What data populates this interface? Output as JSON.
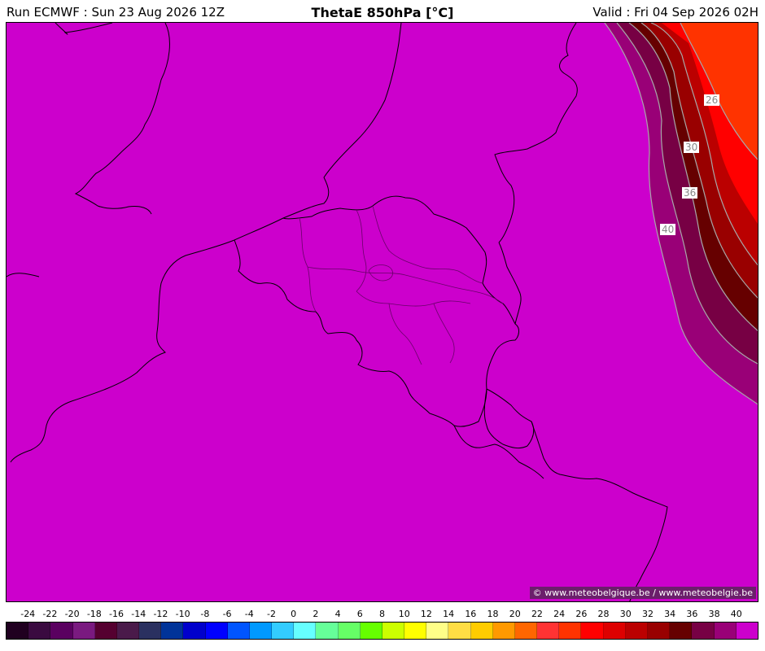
{
  "header": {
    "run": "Run ECMWF : Sun 23 Aug 2026 12Z",
    "title": "ThetaE 850hPa [°C]",
    "valid": "Valid : Fri 04 Sep 2026 02H"
  },
  "map": {
    "credit": "© www.meteobelgique.be / www.meteobelgie.be",
    "contour_labels": [
      "26",
      "30",
      "36",
      "40"
    ],
    "background_color": "#cc00cc"
  },
  "legend": {
    "labels": [
      "-24",
      "-22",
      "-20",
      "-18",
      "-16",
      "-14",
      "-12",
      "-10",
      "-8",
      "-6",
      "-4",
      "-2",
      "0",
      "2",
      "4",
      "6",
      "8",
      "10",
      "12",
      "14",
      "16",
      "18",
      "20",
      "22",
      "24",
      "26",
      "28",
      "30",
      "32",
      "34",
      "36",
      "38",
      "40"
    ],
    "colors": [
      "#200020",
      "#3a0a40",
      "#5a0060",
      "#7a1a80",
      "#550030",
      "#4a1a4a",
      "#2a3060",
      "#003399",
      "#0000cc",
      "#0000ff",
      "#0055ff",
      "#0099ff",
      "#33ccff",
      "#66ffff",
      "#66ff99",
      "#66ff66",
      "#66ff00",
      "#ccff00",
      "#ffff00",
      "#ffff88",
      "#ffdd44",
      "#ffcc00",
      "#ff9900",
      "#ff6600",
      "#ff3333",
      "#ff3300",
      "#ff0000",
      "#dd0000",
      "#bb0000",
      "#990000",
      "#660000",
      "#770044",
      "#990077",
      "#cc00cc"
    ]
  }
}
